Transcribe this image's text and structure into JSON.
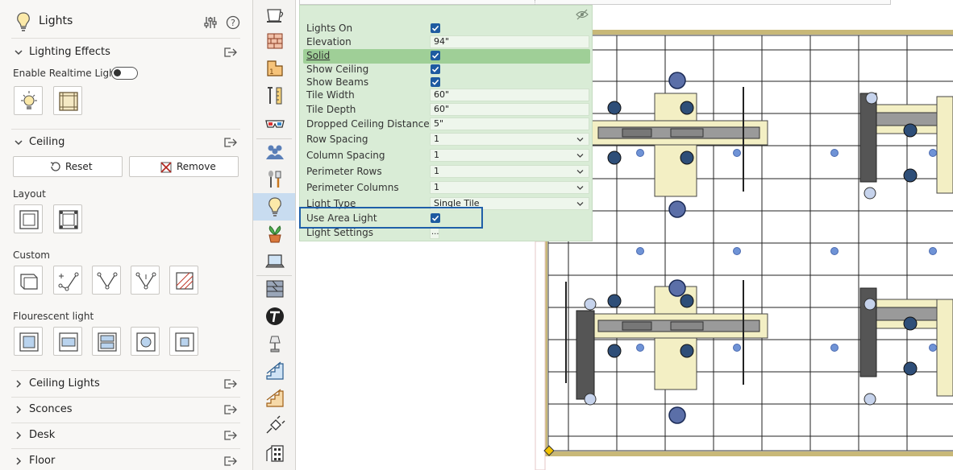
{
  "panel": {
    "title": "Lights",
    "sections": {
      "lighting_effects": {
        "title": "Lighting Effects",
        "toggle_label": "Enable Realtime Lights"
      },
      "ceiling": {
        "title": "Ceiling",
        "reset_label": "Reset",
        "remove_label": "Remove"
      },
      "layout": {
        "title": "Layout"
      },
      "custom": {
        "title": "Custom"
      },
      "flourescent": {
        "title": "Flourescent light"
      },
      "ceiling_lights": {
        "title": "Ceiling Lights"
      },
      "sconces": {
        "title": "Sconces"
      },
      "desk": {
        "title": "Desk"
      },
      "floor": {
        "title": "Floor"
      }
    }
  },
  "properties": [
    {
      "label": "Lights On",
      "type": "checkbox",
      "checked": true
    },
    {
      "label": "Elevation",
      "type": "text",
      "value": "94\""
    },
    {
      "label": "Solid",
      "type": "checkbox",
      "checked": true
    },
    {
      "label": "Show Ceiling",
      "type": "checkbox",
      "checked": true
    },
    {
      "label": "Show Beams",
      "type": "checkbox",
      "checked": true
    },
    {
      "label": "Tile Width",
      "type": "text",
      "value": "60\""
    },
    {
      "label": "Tile Depth",
      "type": "text",
      "value": "60\""
    },
    {
      "label": "Dropped Ceiling Distance",
      "type": "text",
      "value": "5\""
    },
    {
      "label": "Row Spacing",
      "type": "dropdown",
      "value": "1"
    },
    {
      "label": "Column Spacing",
      "type": "dropdown",
      "value": "1"
    },
    {
      "label": "Perimeter Rows",
      "type": "dropdown",
      "value": "1"
    },
    {
      "label": "Perimeter Columns",
      "type": "dropdown",
      "value": "1"
    },
    {
      "label": "Light Type",
      "type": "dropdown",
      "value": "Single Tile"
    },
    {
      "label": "Use Area Light",
      "type": "checkbox",
      "checked": true
    },
    {
      "label": "Light Settings",
      "type": "button",
      "value": "..."
    }
  ],
  "colors": {
    "accent": "#1d5aa0",
    "overlay_bg": "#d9ecd6",
    "selected_row": "#9fcf97",
    "highlight_box": "#1f5fa8",
    "light_dot": "#6f93d6",
    "big_light": "#5b6fa8",
    "desk_cream": "#f3efc4"
  }
}
